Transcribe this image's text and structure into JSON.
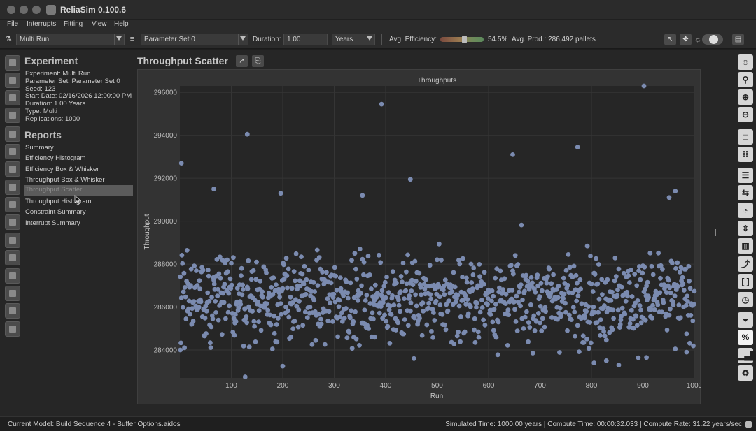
{
  "window": {
    "title": "ReliaSim 0.100.6"
  },
  "menu": [
    "File",
    "Interrupts",
    "Fitting",
    "View",
    "Help"
  ],
  "toolbar": {
    "run_mode": "Multi Run",
    "parameter_set": "Parameter Set 0",
    "duration_label": "Duration:",
    "duration_value": "1.00",
    "duration_unit": "Years",
    "avg_eff_label": "Avg. Efficiency:",
    "avg_eff_value": "54.5%",
    "avg_eff_fraction": 0.545,
    "avg_prod": "Avg. Prod.: 286,492 pallets"
  },
  "experiment": {
    "title": "Experiment",
    "lines": [
      "Experiment: Multi Run",
      "Parameter Set: Parameter Set 0",
      "Seed: 123",
      "Start Date: 02/16/2026 12:00:00 PM",
      "Duration: 1.00 Years",
      "Type: Multi",
      "Replications: 1000"
    ]
  },
  "reports": {
    "title": "Reports",
    "items": [
      "Summary",
      "Efficiency Histogram",
      "Efficiency Box & Whisker",
      "Throughput Box & Whisker",
      "Throughput Scatter",
      "Throughput Histogram",
      "Constraint Summary",
      "Interrupt Summary"
    ],
    "active_index": 4
  },
  "main": {
    "title": "Throughput Scatter"
  },
  "chart_data": {
    "type": "scatter",
    "title": "Throughputs",
    "xlabel": "Run",
    "ylabel": "Throughput",
    "xlim": [
      0,
      1000
    ],
    "ylim": [
      282700,
      296300
    ],
    "x_ticks": [
      100,
      200,
      300,
      400,
      500,
      600,
      700,
      800,
      900,
      1000
    ],
    "y_ticks": [
      284000,
      286000,
      288000,
      290000,
      292000,
      294000,
      296000
    ],
    "y_tick_labels": [
      "284000",
      "286000",
      "288000",
      "290000",
      "292000",
      "294000",
      "296000"
    ],
    "point_color": "#7b8bb0",
    "grid": true,
    "n_points": 1000,
    "center": 286400,
    "spread": 1350,
    "highlighted_points": [
      {
        "x": 3,
        "y": 292700
      },
      {
        "x": 131,
        "y": 294050
      },
      {
        "x": 392,
        "y": 295450
      },
      {
        "x": 448,
        "y": 291950
      },
      {
        "x": 647,
        "y": 293100
      },
      {
        "x": 773,
        "y": 293450
      },
      {
        "x": 902,
        "y": 296300
      },
      {
        "x": 66,
        "y": 291500
      },
      {
        "x": 196,
        "y": 291300
      },
      {
        "x": 355,
        "y": 291200
      },
      {
        "x": 963,
        "y": 291400
      },
      {
        "x": 951,
        "y": 291100
      },
      {
        "x": 127,
        "y": 282750
      },
      {
        "x": 200,
        "y": 283250
      },
      {
        "x": 805,
        "y": 283400
      },
      {
        "x": 829,
        "y": 283500
      },
      {
        "x": 853,
        "y": 283300
      },
      {
        "x": 455,
        "y": 283600
      },
      {
        "x": 1,
        "y": 284000
      },
      {
        "x": 985,
        "y": 283900
      },
      {
        "x": 907,
        "y": 283650
      }
    ]
  },
  "right_toolbar": [
    "smiley",
    "pin",
    "zoom-in",
    "zoom-out",
    "square",
    "grid",
    "list",
    "shuffle",
    "gauge",
    "split",
    "book",
    "fork",
    "bracket",
    "timer",
    "funnel",
    "%",
    "bars",
    "trash"
  ],
  "status": {
    "model": "Current Model: Build Sequence 4 - Buffer Options.aidos",
    "metrics": "Simulated Time: 1000.00 years | Compute Time: 00:00:32.033 | Compute Rate: 31.22 years/sec"
  }
}
